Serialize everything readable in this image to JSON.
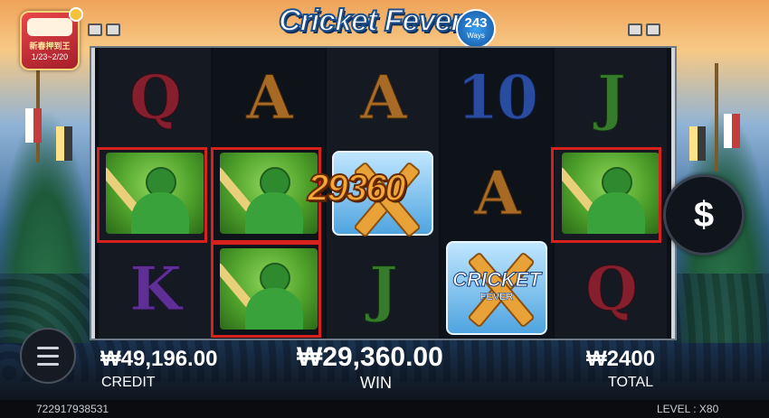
{
  "promo": {
    "title": "新春押到王",
    "dates": "1/23~2/20"
  },
  "logo": {
    "text": "Cricket Fever",
    "ways_number": "243",
    "ways_label": "Ways"
  },
  "reels": {
    "row1": [
      "Q",
      "A",
      "A",
      "10",
      "J"
    ],
    "row2": [
      "batsman",
      "batsman",
      "wild",
      "A",
      "batsman"
    ],
    "row3": [
      "K",
      "batsman",
      "J",
      "wild",
      "Q"
    ]
  },
  "wild": {
    "title": "CRICKET",
    "sub": "FEVER"
  },
  "big_win_value": "29360",
  "hud": {
    "credit_value": "₩49,196.00",
    "credit_label": "CREDIT",
    "win_value": "₩29,360.00",
    "win_label": "WIN",
    "total_value": "₩2400",
    "total_label": "TOTAL"
  },
  "footer": {
    "round_id": "722917938531",
    "level_label": "LEVEL : X80"
  },
  "icons": {
    "spin": "dollar-icon",
    "menu": "hamburger-menu-icon"
  },
  "colors": {
    "win_frame": "#d6211c",
    "big_win": "#f6a73a"
  }
}
